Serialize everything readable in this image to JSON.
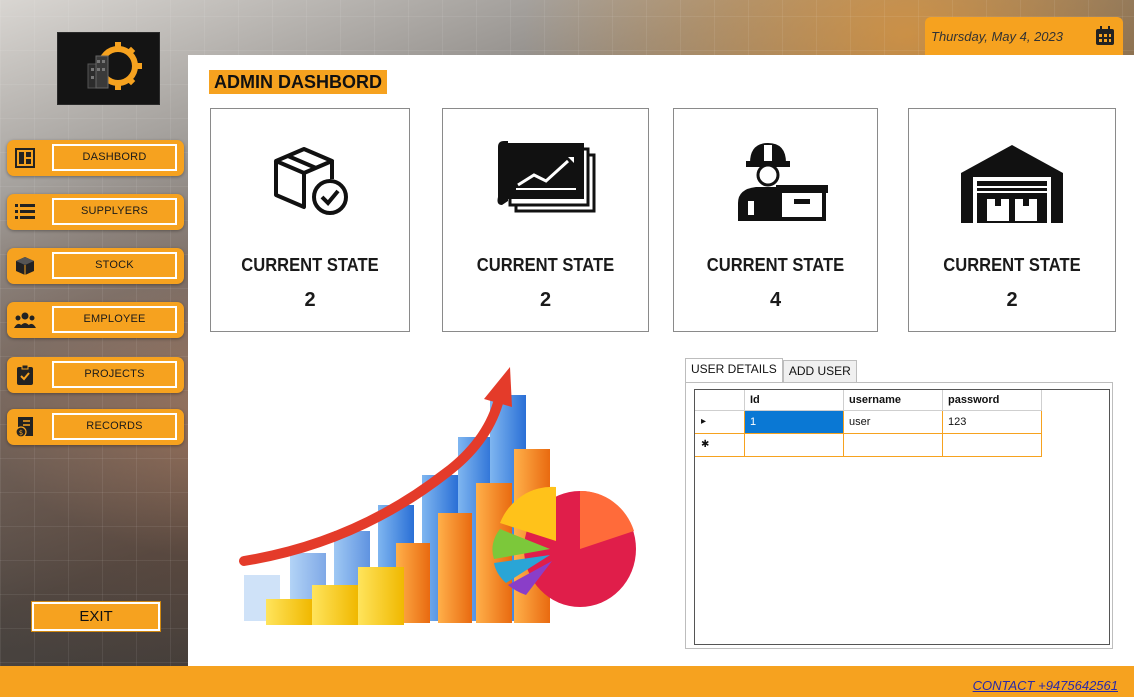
{
  "header": {
    "date": "Thursday, May 4, 2023",
    "calendar_icon": "calendar-icon"
  },
  "sidebar": {
    "items": [
      {
        "label": "DASHBORD",
        "icon": "dashboard-icon"
      },
      {
        "label": "SUPPLYERS",
        "icon": "list-icon"
      },
      {
        "label": "STOCK",
        "icon": "box-icon"
      },
      {
        "label": "EMPLOYEE",
        "icon": "people-icon"
      },
      {
        "label": "PROJECTS",
        "icon": "clipboard-icon"
      },
      {
        "label": "RECORDS",
        "icon": "records-icon"
      }
    ],
    "exit_label": "EXIT"
  },
  "main": {
    "title": "ADMIN DASHBORD",
    "cards": [
      {
        "label": "CURRENT STATE",
        "value": "2",
        "icon": "box-check-icon"
      },
      {
        "label": "CURRENT STATE",
        "value": "2",
        "icon": "chart-report-icon"
      },
      {
        "label": "CURRENT STATE",
        "value": "4",
        "icon": "worker-icon"
      },
      {
        "label": "CURRENT STATE",
        "value": "2",
        "icon": "warehouse-icon"
      }
    ],
    "tabs": [
      {
        "label": "USER DETAILS",
        "active": true
      },
      {
        "label": "ADD USER",
        "active": false
      }
    ],
    "grid": {
      "columns": [
        "Id",
        "username",
        "password"
      ],
      "rows": [
        {
          "marker": "▸",
          "cells": [
            "1",
            "user",
            "123"
          ]
        },
        {
          "marker": "✱",
          "cells": [
            "",
            "",
            ""
          ]
        }
      ]
    }
  },
  "footer": {
    "contact": "CONTACT  +9475642561"
  },
  "colors": {
    "accent": "#f6a21f",
    "selection": "#0a78d4",
    "link": "#2a2aa8"
  }
}
